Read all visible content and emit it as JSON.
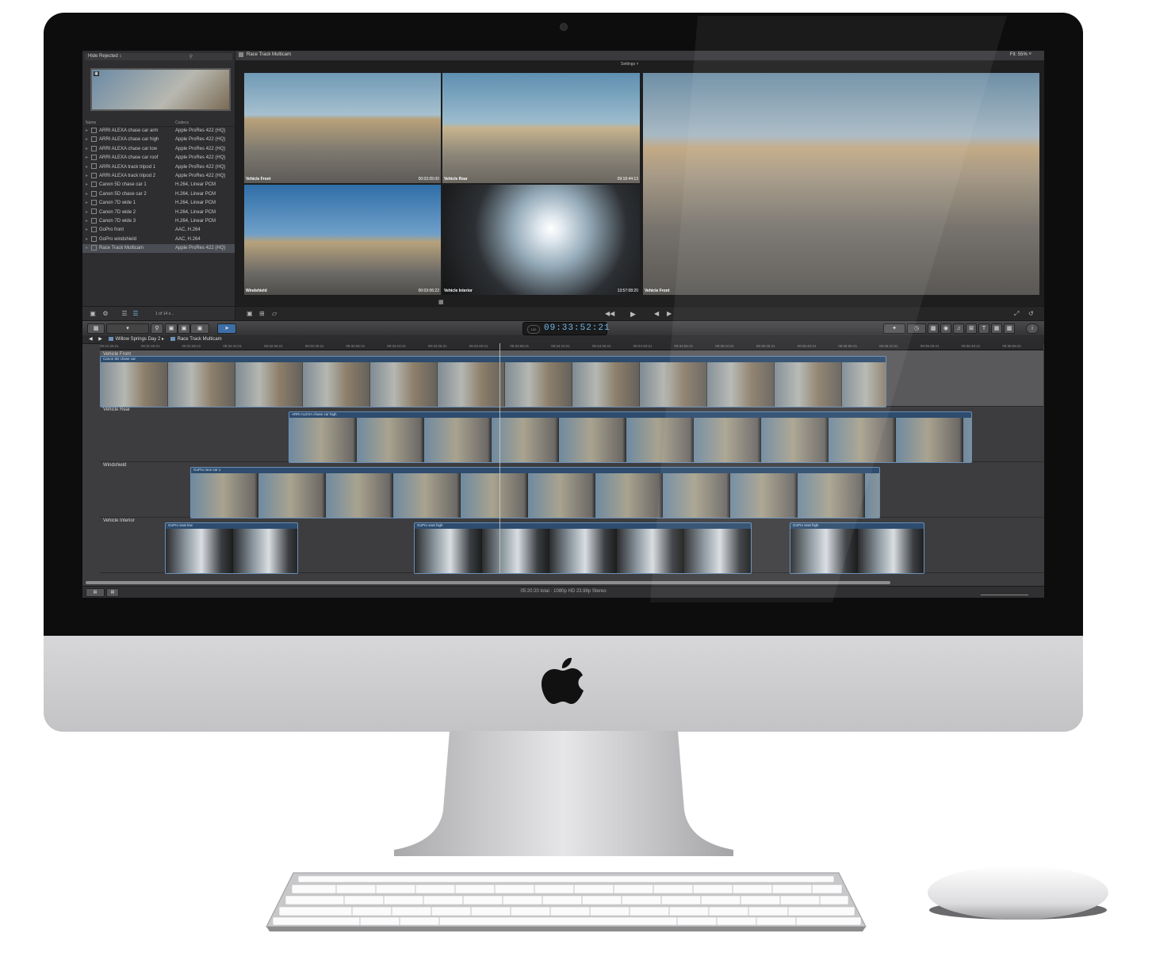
{
  "library": {
    "filter_label": "Hide Rejected ↕",
    "columns": {
      "name": "Name",
      "codec": "Codecs"
    },
    "rows": [
      {
        "name": "ARRI ALEXA chase car arm",
        "codec": "Apple ProRes 422 (HQ)"
      },
      {
        "name": "ARRI ALEXA chase car high",
        "codec": "Apple ProRes 422 (HQ)"
      },
      {
        "name": "ARRI ALEXA chase car low",
        "codec": "Apple ProRes 422 (HQ)"
      },
      {
        "name": "ARRI ALEXA chase car roof",
        "codec": "Apple ProRes 422 (HQ)"
      },
      {
        "name": "ARRI ALEXA track tripod 1",
        "codec": "Apple ProRes 422 (HQ)"
      },
      {
        "name": "ARRI ALEXA track tripod 2",
        "codec": "Apple ProRes 422 (HQ)"
      },
      {
        "name": "Canon 5D chase car 1",
        "codec": "H.264, Linear PCM"
      },
      {
        "name": "Canon 5D chase car 2",
        "codec": "H.264, Linear PCM"
      },
      {
        "name": "Canon 7D wide 1",
        "codec": "H.264, Linear PCM"
      },
      {
        "name": "Canon 7D wide 2",
        "codec": "H.264, Linear PCM"
      },
      {
        "name": "Canon 7D wide 3",
        "codec": "H.264, Linear PCM"
      },
      {
        "name": "GoPro front",
        "codec": "AAC, H.264"
      },
      {
        "name": "GoPro windshield",
        "codec": "AAC, H.264"
      },
      {
        "name": "Race Track Multicam",
        "codec": "Apple ProRes 422 (HQ)"
      }
    ],
    "selected_index": 13,
    "count_label": "1 of 14 s..."
  },
  "viewer": {
    "title": "Race Track Multicam",
    "fit": "Fit:  55%  ˅",
    "settings": "Settings  ˅",
    "angles": [
      {
        "label": "Vehicle Front",
        "timecode": "00:03:05:00"
      },
      {
        "label": "Vehicle Rear",
        "timecode": "09:18:44:13"
      },
      {
        "label": "Windshield",
        "timecode": "00:03:06:22"
      },
      {
        "label": "Vehicle Interior",
        "timecode": "13:57:08:20"
      }
    ],
    "main_label": "Vehicle Front"
  },
  "toolbar": {
    "timecode": "09:33:52:21",
    "timecode_badge": "100"
  },
  "timeline": {
    "breadcrumb_project": "Willow Springs Day 2",
    "breadcrumb_clip": "Race Track Multicam",
    "ruler_ticks": [
      "09:31:25:21",
      "09:31:40:21",
      "09:31:55:21",
      "09:32:10:21",
      "09:32:25:21",
      "09:32:40:21",
      "09:32:55:21",
      "09:33:10:21",
      "09:33:25:21",
      "09:33:40:21",
      "09:33:55:21",
      "09:34:10:21",
      "09:34:25:21",
      "09:34:40:21",
      "09:34:55:21",
      "09:35:10:21",
      "09:35:25:21",
      "09:35:40:21",
      "09:35:55:21",
      "09:36:10:21",
      "09:36:25:21",
      "09:36:40:21",
      "09:36:55:21"
    ],
    "tracks": [
      {
        "label": "Vehicle Front",
        "clips": [
          {
            "name": "Canon 5D chase car"
          }
        ]
      },
      {
        "label": "Vehicle Rear",
        "clips": [
          {
            "name": "ARRI ALEXA chase car high"
          }
        ]
      },
      {
        "label": "Windshield",
        "clips": [
          {
            "name": "GoPro race car 1"
          }
        ]
      },
      {
        "label": "Vehicle Interior",
        "clips": [
          {
            "name": "GoPro seat low"
          },
          {
            "name": "GoPro seat high"
          },
          {
            "name": "GoPro seat high"
          }
        ]
      }
    ],
    "status": "05:20:20 total · 1080p HD 23.98p Stereo"
  },
  "colors": {
    "accent": "#3d6ea8",
    "timecode": "#6fb7e6",
    "clip_border": "#6b8fb6"
  }
}
